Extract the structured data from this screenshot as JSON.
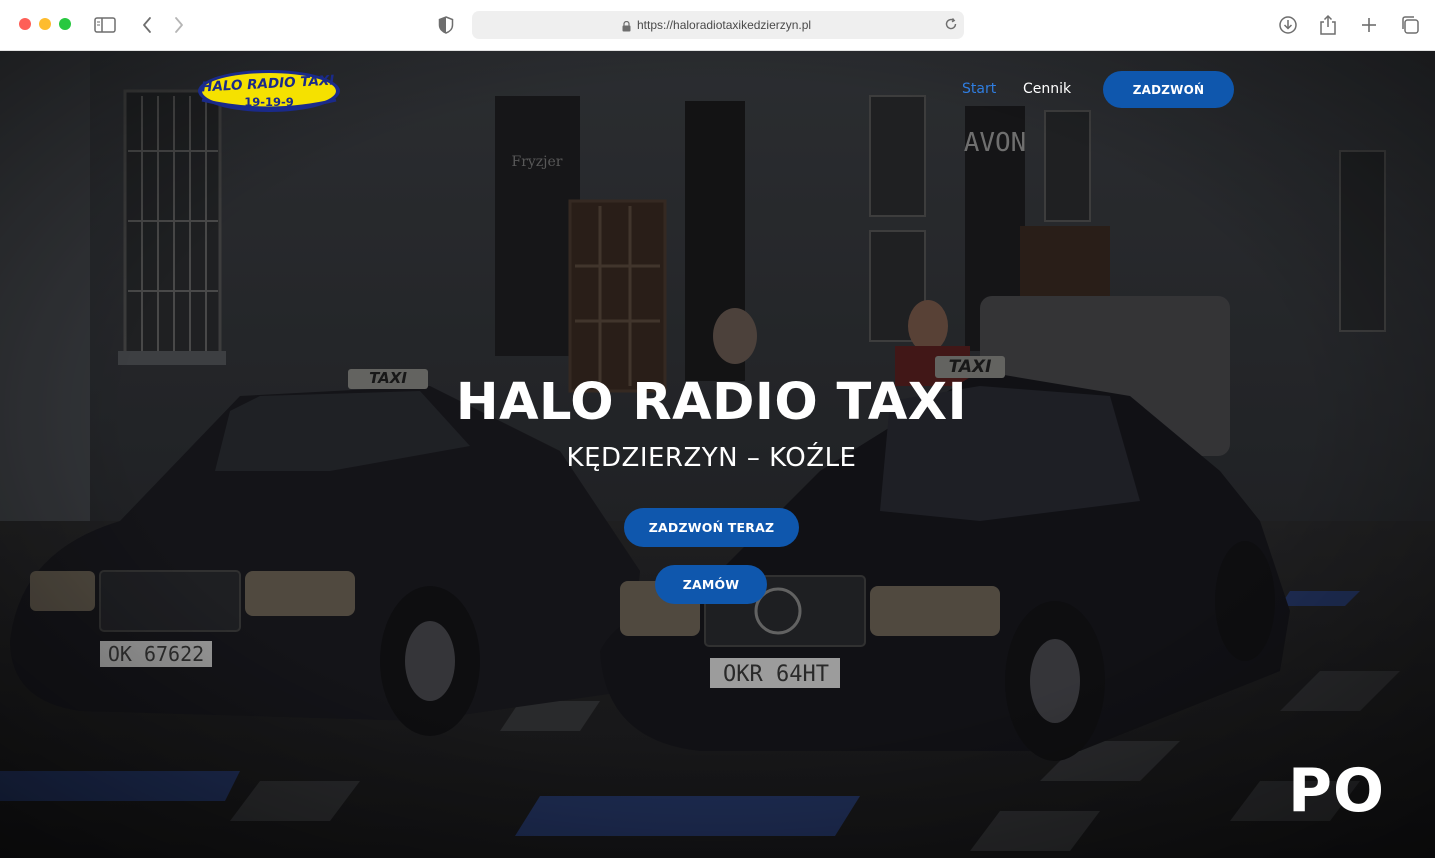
{
  "browser": {
    "url": "https://haloradiotaxikedzierzyn.pl"
  },
  "logo": {
    "line1": "HALO RADIO TAXI",
    "line2": "19-19-9",
    "colors": {
      "fill": "#f5e100",
      "outline": "#1a2a8a"
    }
  },
  "nav": {
    "items": [
      "Start",
      "Cennik"
    ],
    "active": "Start",
    "call_button": "ZADZWOŃ"
  },
  "hero": {
    "title": "HALO RADIO TAXI",
    "subtitle": "KĘDZIERZYN – KOŹLE",
    "buttons": [
      "ZADZWOŃ TERAZ",
      "ZAMÓW"
    ],
    "plates": [
      "OK 67622",
      "OKR 64HT"
    ],
    "sign_texts": [
      "TAXI",
      "TAXI",
      "AVON",
      "Fryzjer"
    ]
  },
  "corner_text": "PO",
  "colors": {
    "accent": "#0f57ad",
    "nav_active": "#2f7de0"
  },
  "icons": [
    "sidebar-icon",
    "back-icon",
    "forward-icon",
    "shield-icon",
    "lock-icon",
    "reload-icon",
    "download-icon",
    "share-icon",
    "new-tab-icon",
    "tabs-icon"
  ]
}
